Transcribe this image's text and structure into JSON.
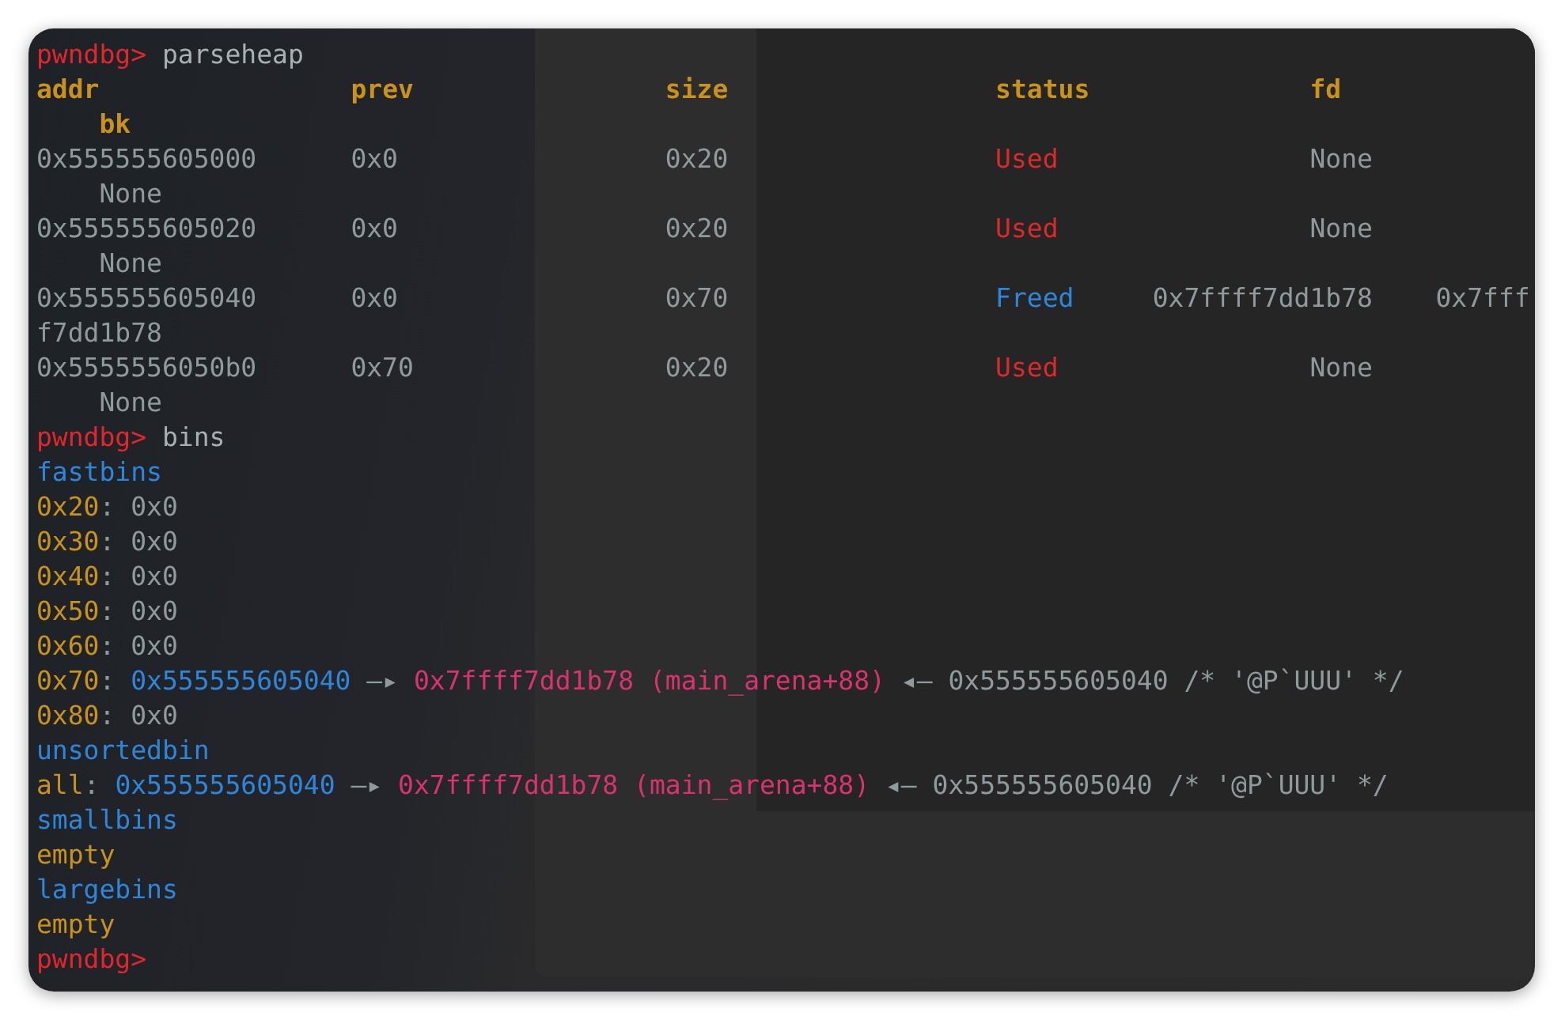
{
  "terminal": {
    "lines": [
      [
        {
          "text": "pwndbg> ",
          "kind": "prompt"
        },
        {
          "text": "parseheap",
          "kind": "command"
        }
      ],
      [
        {
          "text": "addr                ",
          "kind": "header"
        },
        {
          "text": "prev                ",
          "kind": "header"
        },
        {
          "text": "size                 ",
          "kind": "header"
        },
        {
          "text": "status              ",
          "kind": "header"
        },
        {
          "text": "fd",
          "kind": "header"
        }
      ],
      [
        {
          "text": "    bk",
          "kind": "header"
        }
      ],
      [
        {
          "text": "0x555555605000      ",
          "kind": "value"
        },
        {
          "text": "0x0                 ",
          "kind": "value"
        },
        {
          "text": "0x20                 ",
          "kind": "value"
        },
        {
          "text": "Used                ",
          "kind": "used"
        },
        {
          "text": "None",
          "kind": "value"
        }
      ],
      [
        {
          "text": "    None",
          "kind": "value"
        }
      ],
      [
        {
          "text": "0x555555605020      ",
          "kind": "value"
        },
        {
          "text": "0x0                 ",
          "kind": "value"
        },
        {
          "text": "0x20                 ",
          "kind": "value"
        },
        {
          "text": "Used                ",
          "kind": "used"
        },
        {
          "text": "None",
          "kind": "value"
        }
      ],
      [
        {
          "text": "    None",
          "kind": "value"
        }
      ],
      [
        {
          "text": "0x555555605040      ",
          "kind": "value"
        },
        {
          "text": "0x0                 ",
          "kind": "value"
        },
        {
          "text": "0x70                 ",
          "kind": "value"
        },
        {
          "text": "Freed     ",
          "kind": "freed"
        },
        {
          "text": "0x7ffff7dd1b78    ",
          "kind": "value"
        },
        {
          "text": "0x7fff",
          "kind": "value"
        }
      ],
      [
        {
          "text": "f7dd1b78",
          "kind": "value"
        }
      ],
      [
        {
          "text": "0x5555556050b0      ",
          "kind": "value"
        },
        {
          "text": "0x70                ",
          "kind": "value"
        },
        {
          "text": "0x20                 ",
          "kind": "value"
        },
        {
          "text": "Used                ",
          "kind": "used"
        },
        {
          "text": "None",
          "kind": "value"
        }
      ],
      [
        {
          "text": "    None",
          "kind": "value"
        }
      ],
      [
        {
          "text": "pwndbg> ",
          "kind": "prompt"
        },
        {
          "text": "bins",
          "kind": "command"
        }
      ],
      [
        {
          "text": "fastbins",
          "kind": "section"
        }
      ],
      [
        {
          "text": "0x20",
          "kind": "key"
        },
        {
          "text": ": 0x0",
          "kind": "value"
        }
      ],
      [
        {
          "text": "0x30",
          "kind": "key"
        },
        {
          "text": ": 0x0",
          "kind": "value"
        }
      ],
      [
        {
          "text": "0x40",
          "kind": "key"
        },
        {
          "text": ": 0x0",
          "kind": "value"
        }
      ],
      [
        {
          "text": "0x50",
          "kind": "key"
        },
        {
          "text": ": 0x0",
          "kind": "value"
        }
      ],
      [
        {
          "text": "0x60",
          "kind": "key"
        },
        {
          "text": ": 0x0",
          "kind": "value"
        }
      ],
      [
        {
          "text": "0x70",
          "kind": "key"
        },
        {
          "text": ": ",
          "kind": "value"
        },
        {
          "text": "0x555555605040 ",
          "kind": "section"
        },
        {
          "text": "—▸ ",
          "kind": "value"
        },
        {
          "text": "0x7ffff7dd1b78 (main_arena+88) ",
          "kind": "libc"
        },
        {
          "text": "◂— 0x555555605040 /* '@P`UUU' */",
          "kind": "value"
        }
      ],
      [
        {
          "text": "0x80",
          "kind": "key"
        },
        {
          "text": ": 0x0",
          "kind": "value"
        }
      ],
      [
        {
          "text": "unsortedbin",
          "kind": "section"
        }
      ],
      [
        {
          "text": "all",
          "kind": "key"
        },
        {
          "text": ": ",
          "kind": "value"
        },
        {
          "text": "0x555555605040 ",
          "kind": "section"
        },
        {
          "text": "—▸ ",
          "kind": "value"
        },
        {
          "text": "0x7ffff7dd1b78 (main_arena+88) ",
          "kind": "libc"
        },
        {
          "text": "◂— 0x555555605040 /* '@P`UUU' */",
          "kind": "value"
        }
      ],
      [
        {
          "text": "smallbins",
          "kind": "section"
        }
      ],
      [
        {
          "text": "empty",
          "kind": "key"
        }
      ],
      [
        {
          "text": "largebins",
          "kind": "section"
        }
      ],
      [
        {
          "text": "empty",
          "kind": "key"
        }
      ],
      [
        {
          "text": "pwndbg>",
          "kind": "prompt"
        }
      ]
    ]
  }
}
